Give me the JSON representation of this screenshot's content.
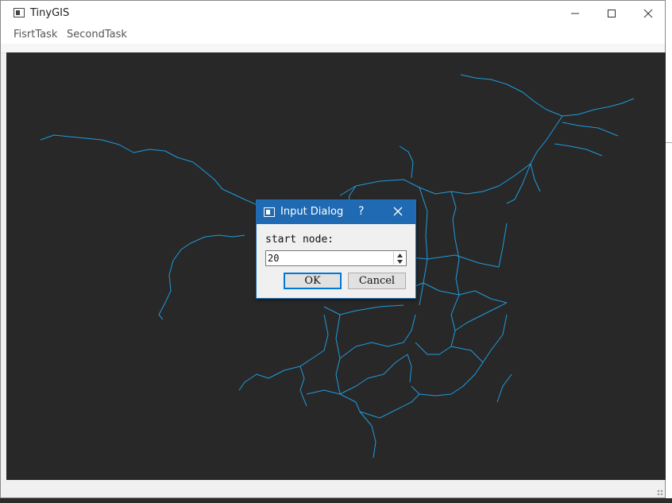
{
  "window": {
    "title": "TinyGIS",
    "menu": [
      "FisrtTask",
      "SecondTask"
    ]
  },
  "dialog": {
    "title": "Input Dialog",
    "help": "?",
    "label": "start node:",
    "value": "20",
    "ok_label": "OK",
    "cancel_label": "Cancel"
  },
  "colors": {
    "canvas_bg": "#282828",
    "network_line": "#1f9bdc",
    "dialog_titlebar": "#1f6ab3"
  },
  "icons": {
    "app": "app-window-icon",
    "minimize": "minimize-icon",
    "maximize": "maximize-icon",
    "close": "close-icon"
  }
}
